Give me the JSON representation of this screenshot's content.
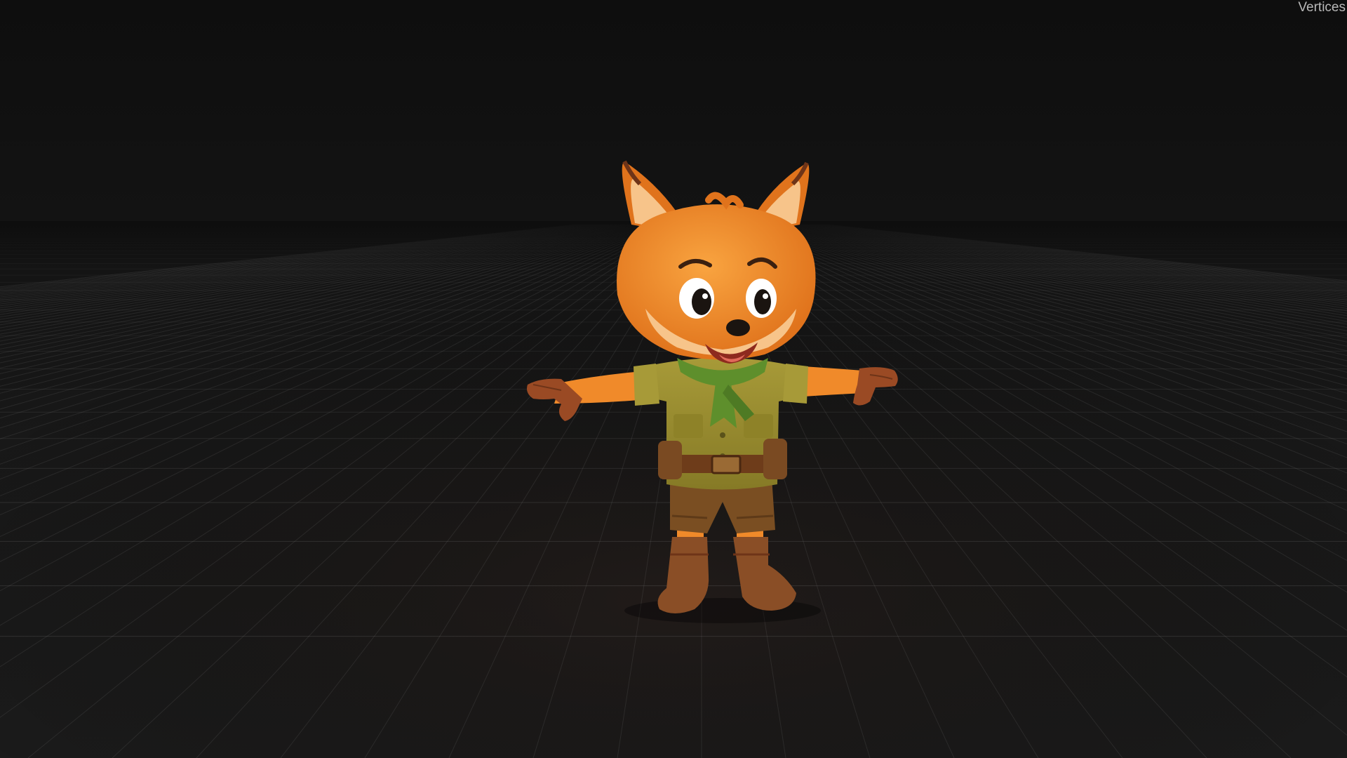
{
  "viewport": {
    "stats_label": "Vertices",
    "background_color": "#141414",
    "grid_color": "#8a8a8a"
  },
  "model": {
    "name": "fox-scout-character",
    "pose": "T-pose",
    "colors": {
      "fur": "#f08a2a",
      "fur_light": "#f7c48a",
      "shirt": "#9a8c2e",
      "neckerchief": "#5e8f2c",
      "shorts": "#7a4e22",
      "boots": "#8a4e26",
      "belt": "#6e3c1a",
      "gloves": "#9a4a24"
    }
  }
}
